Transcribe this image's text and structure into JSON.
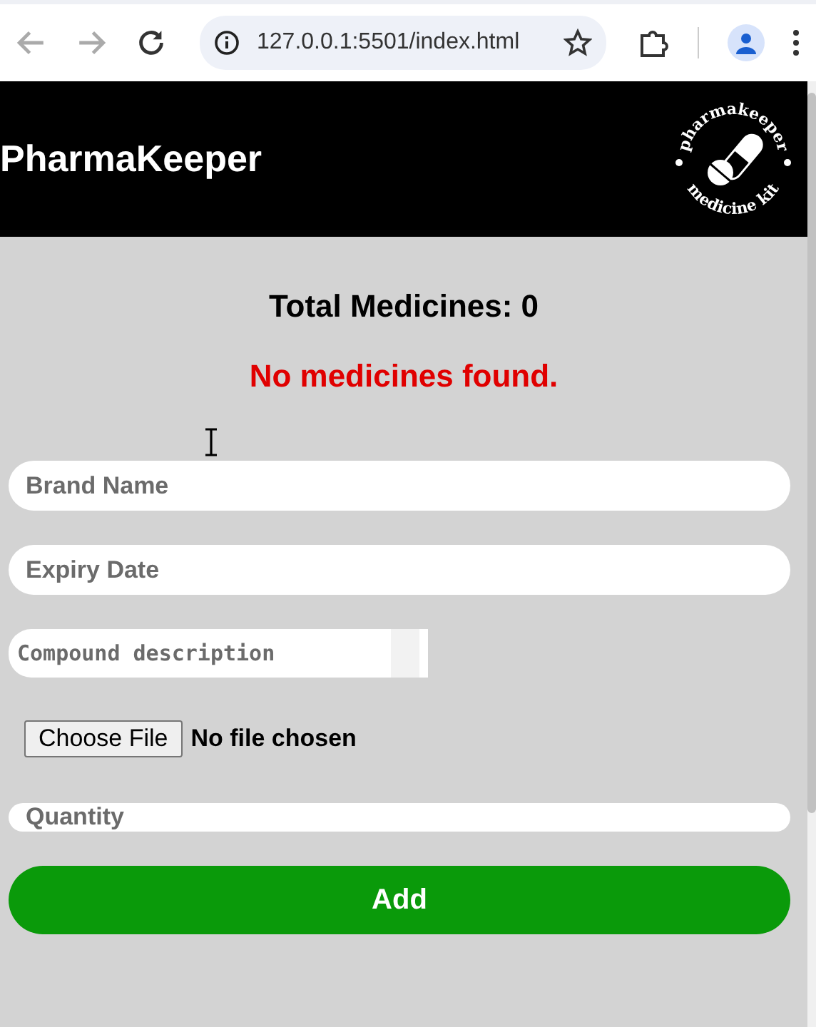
{
  "browser": {
    "url": "127.0.0.1:5501/index.html"
  },
  "header": {
    "title": "PharmaKeeper",
    "logo": {
      "top_text": "pharmakeeper",
      "bottom_text": "medicine kit"
    }
  },
  "summary": {
    "total": "Total Medicines: 0",
    "empty_message": "No medicines found."
  },
  "form": {
    "fields": [
      {
        "kind": "input",
        "placeholder": "Brand Name"
      },
      {
        "kind": "input",
        "placeholder": "Expiry Date"
      },
      {
        "kind": "textarea",
        "placeholder": "Compound description"
      },
      {
        "kind": "file",
        "button": "Choose File",
        "status": "No file chosen"
      },
      {
        "kind": "short",
        "placeholder": "Quantity"
      }
    ],
    "submit": "Add"
  }
}
